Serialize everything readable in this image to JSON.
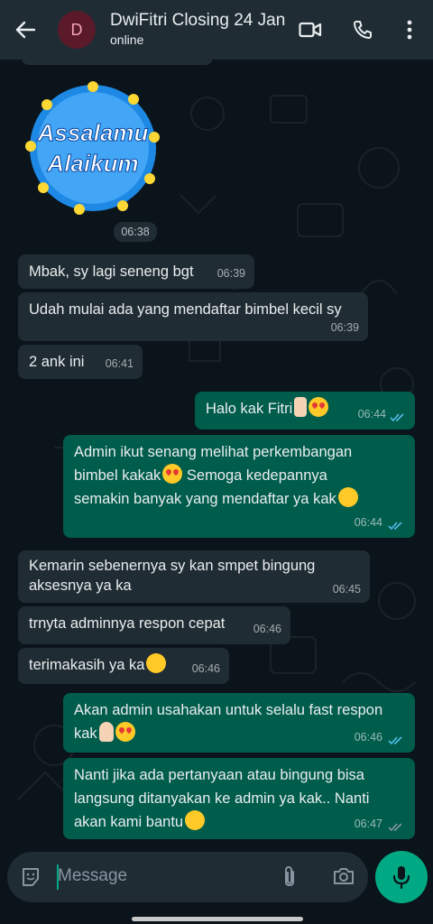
{
  "header": {
    "avatar_letter": "D",
    "contact_name": "DwiFitri Closing 24 Jan",
    "status": "online"
  },
  "sticker": {
    "line1": "Assalamu",
    "line2": "Alaikum",
    "time": "06:38"
  },
  "messages": [
    {
      "dir": "in",
      "text": "Mbak, sy lagi seneng bgt",
      "time": "06:39"
    },
    {
      "dir": "in",
      "text": "Udah mulai ada yang mendaftar bimbel kecil sy",
      "time": "06:39"
    },
    {
      "dir": "in",
      "text": "2 ank ini",
      "time": "06:41"
    },
    {
      "dir": "out",
      "text": "Halo kak Fitri",
      "time": "06:44"
    },
    {
      "dir": "out",
      "l1": "Admin ikut senang melihat perkembangan",
      "l2": "bimbel kakak",
      "l2b": " Semoga kedepannya",
      "l3": "semakin banyak yang mendaftar ya kak",
      "time": "06:44"
    },
    {
      "dir": "in",
      "l1": "Kemarin sebenernya sy kan smpet bingung",
      "l2": "aksesnya ya ka",
      "time": "06:45"
    },
    {
      "dir": "in",
      "text": "trnyta adminnya respon cepat",
      "time": "06:46"
    },
    {
      "dir": "in",
      "text": "terimakasih ya ka",
      "time": "06:46"
    },
    {
      "dir": "out",
      "l1": "Akan admin usahakan untuk selalu fast respon",
      "l2": "kak",
      "time": "06:46"
    },
    {
      "dir": "out",
      "l1": "Nanti jika ada pertanyaan atau bingung bisa",
      "l2": "langsung ditanyakan ke admin ya kak.. Nanti",
      "l3": "akan kami bantu",
      "time": "06:47"
    }
  ],
  "input": {
    "placeholder": "Message"
  }
}
